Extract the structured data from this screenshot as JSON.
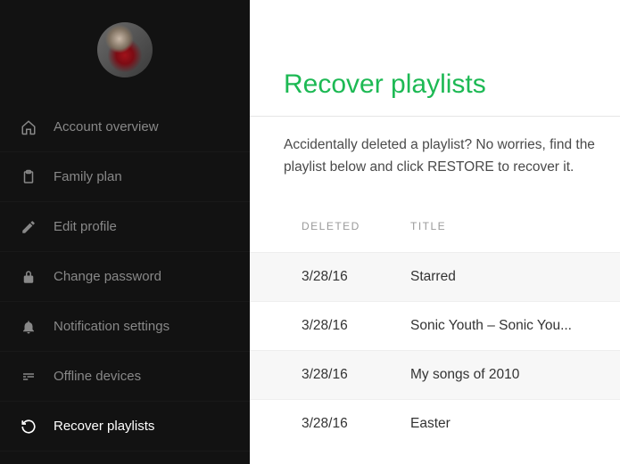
{
  "accent": "#1db954",
  "sidebar": {
    "items": [
      {
        "label": "Account overview",
        "icon": "home-icon"
      },
      {
        "label": "Family plan",
        "icon": "clipboard-icon"
      },
      {
        "label": "Edit profile",
        "icon": "pencil-icon"
      },
      {
        "label": "Change password",
        "icon": "lock-icon"
      },
      {
        "label": "Notification settings",
        "icon": "bell-icon"
      },
      {
        "label": "Offline devices",
        "icon": "devices-icon"
      },
      {
        "label": "Recover playlists",
        "icon": "refresh-icon"
      }
    ],
    "active_index": 6
  },
  "page": {
    "title": "Recover playlists",
    "description": "Accidentally deleted a playlist? No worries, find the playlist below and click RESTORE to recover it."
  },
  "table": {
    "headers": {
      "deleted": "DELETED",
      "title": "TITLE"
    },
    "rows": [
      {
        "deleted": "3/28/16",
        "title": "Starred"
      },
      {
        "deleted": "3/28/16",
        "title": "Sonic Youth – Sonic You..."
      },
      {
        "deleted": "3/28/16",
        "title": "My songs of 2010"
      },
      {
        "deleted": "3/28/16",
        "title": "Easter"
      }
    ]
  }
}
